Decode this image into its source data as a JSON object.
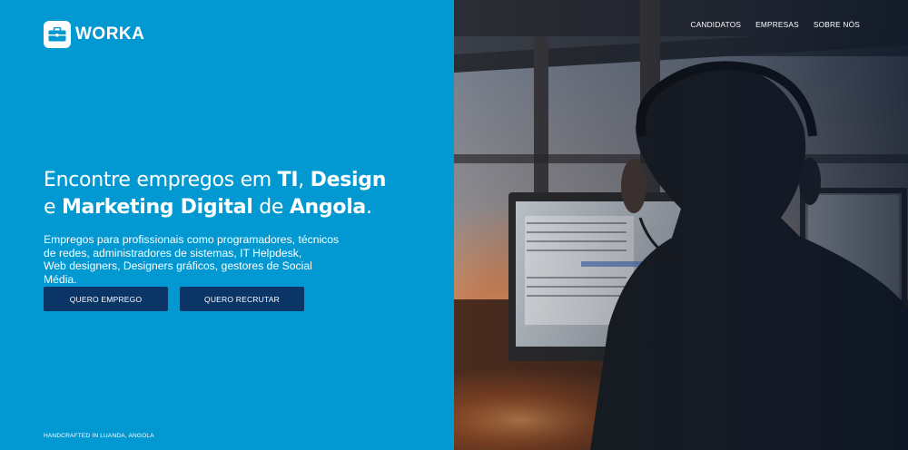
{
  "brand": {
    "name": "WORKA",
    "icon": "briefcase-icon",
    "color": "#0299d2"
  },
  "nav": {
    "items": [
      "CANDIDATOS",
      "EMPRESAS",
      "SOBRE NÓS"
    ]
  },
  "hero": {
    "line1_a": "Encontre  empregos em ",
    "line1_b": "TI",
    "line1_c": ", ",
    "line1_d": "Design",
    "line2_a": "e ",
    "line2_b": "Marketing Digital",
    "line2_c": " de ",
    "line2_d": "Angola",
    "line2_e": ".",
    "sub1": "Empregos para profissionais como programadores, técnicos",
    "sub2": "de redes, administradores de sistemas, IT Helpdesk,",
    "sub3": "Web designers, Designers gráficos, gestores de Social Média."
  },
  "buttons": {
    "job": "QUERO EMPREGO",
    "recruit": "QUERO RECRUTAR",
    "color": "#0b3567"
  },
  "footer": {
    "text": "HANDCRAFTED IN LUANDA, ANGOLA"
  }
}
